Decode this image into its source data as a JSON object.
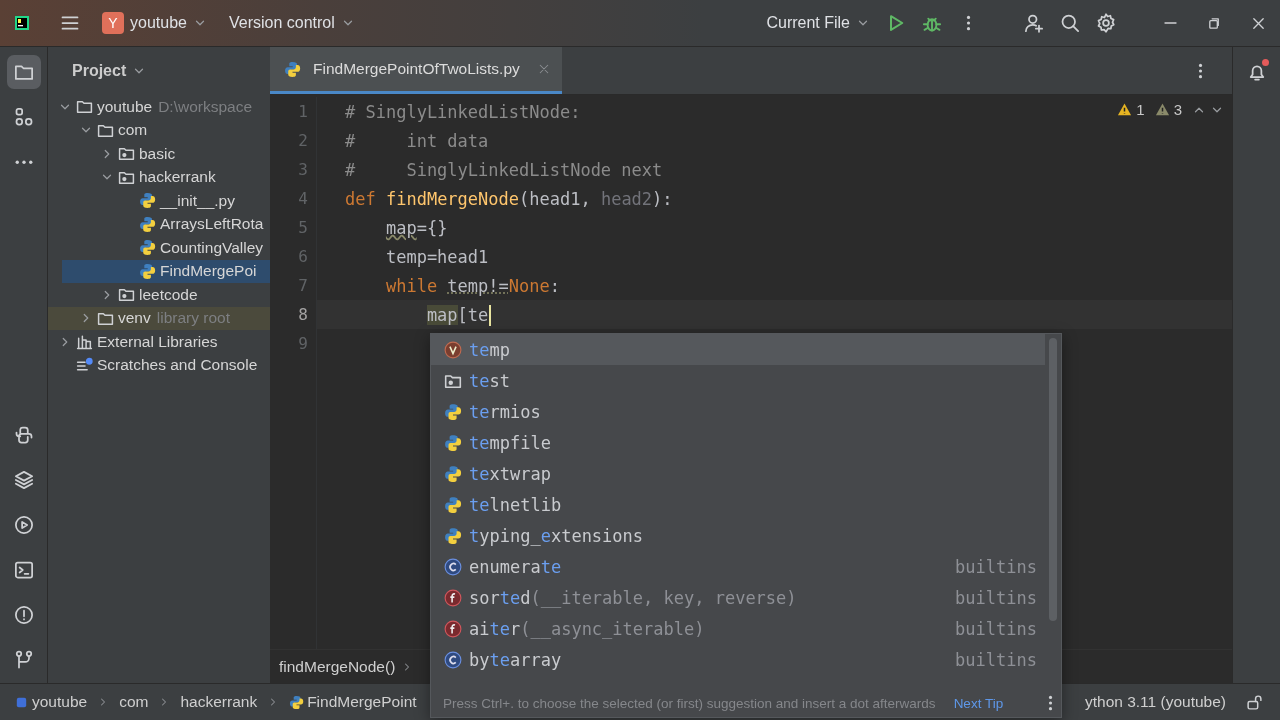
{
  "title_bar": {
    "project_badge": "Y",
    "project": "youtube",
    "vcs": "Version control",
    "run_config": "Current File"
  },
  "project_panel": {
    "title": "Project",
    "tree": [
      {
        "label": "youtube",
        "hint": "D:\\workspace",
        "kind": "folder",
        "expanded": true,
        "selected": false,
        "children": [
          {
            "label": "com",
            "kind": "folder",
            "expanded": true,
            "selected": false,
            "children": [
              {
                "label": "basic",
                "kind": "package",
                "expanded": false,
                "selected": false
              },
              {
                "label": "hackerrank",
                "kind": "package",
                "expanded": true,
                "selected": false,
                "children": [
                  {
                    "label": "__init__.py",
                    "kind": "python",
                    "selected": false
                  },
                  {
                    "label": "ArraysLeftRota",
                    "kind": "python",
                    "selected": false
                  },
                  {
                    "label": "CountingValley",
                    "kind": "python",
                    "selected": false
                  },
                  {
                    "label": "FindMergePoi",
                    "kind": "python",
                    "selected": true
                  }
                ]
              },
              {
                "label": "leetcode",
                "kind": "package",
                "expanded": false,
                "selected": false
              }
            ]
          },
          {
            "label": "venv",
            "hint": "library root",
            "kind": "library-root",
            "expanded": false,
            "selected": false
          }
        ]
      },
      {
        "label": "External Libraries",
        "kind": "libraries",
        "expanded": false,
        "selected": false
      },
      {
        "label": "Scratches and Console",
        "kind": "scratches",
        "selected": false
      }
    ]
  },
  "editor": {
    "tab": {
      "label": "FindMergePointOfTwoLists.py",
      "selected": true
    },
    "inspections": [
      {
        "kind": "warning",
        "count": "1"
      },
      {
        "kind": "weak-warning",
        "count": "3"
      }
    ],
    "lines": [
      {
        "number": "1",
        "current": false,
        "tokens": [
          {
            "kind": "comment",
            "text": "# SinglyLinkedListNode:"
          }
        ]
      },
      {
        "number": "2",
        "current": false,
        "tokens": [
          {
            "kind": "comment",
            "text": "#     int data"
          }
        ]
      },
      {
        "number": "3",
        "current": false,
        "tokens": [
          {
            "kind": "comment",
            "text": "#     SinglyLinkedListNode next"
          }
        ]
      },
      {
        "number": "4",
        "current": false,
        "tokens": [
          {
            "kind": "keyword",
            "text": "def "
          },
          {
            "kind": "function",
            "text": "findMergeNode"
          },
          {
            "kind": "plain",
            "text": "(head1, "
          },
          {
            "kind": "unused",
            "text": "head2"
          },
          {
            "kind": "plain",
            "text": "):"
          }
        ],
        "children": [
          {
            "number": "5",
            "current": false,
            "tokens": [
              {
                "kind": "warned",
                "text": "map"
              },
              {
                "kind": "plain",
                "text": "={}"
              }
            ]
          },
          {
            "number": "6",
            "current": false,
            "tokens": [
              {
                "kind": "plain",
                "text": "temp=head1"
              }
            ]
          },
          {
            "number": "7",
            "current": false,
            "tokens": [
              {
                "kind": "keyword",
                "text": "while "
              },
              {
                "kind": "dotted",
                "text": "temp!="
              },
              {
                "kind": "keyword",
                "text": "None"
              },
              {
                "kind": "plain",
                "text": ":"
              }
            ],
            "children": [
              {
                "number": "8",
                "current": true,
                "caret": true,
                "tokens": [
                  {
                    "kind": "highlight",
                    "text": "map"
                  },
                  {
                    "kind": "plain",
                    "text": "[te"
                  }
                ]
              }
            ]
          }
        ]
      },
      {
        "number": "9",
        "current": false
      }
    ],
    "breadcrumb": [
      "findMergeNode()"
    ]
  },
  "completion": {
    "items": [
      {
        "kind": "variable",
        "selected": true,
        "parts": [
          {
            "kind": "match",
            "text": "te"
          },
          {
            "kind": "text",
            "text": "mp"
          }
        ]
      },
      {
        "kind": "folder",
        "selected": false,
        "parts": [
          {
            "kind": "match",
            "text": "te"
          },
          {
            "kind": "text",
            "text": "st"
          }
        ]
      },
      {
        "kind": "python",
        "selected": false,
        "parts": [
          {
            "kind": "match",
            "text": "te"
          },
          {
            "kind": "text",
            "text": "rmios"
          }
        ]
      },
      {
        "kind": "python",
        "selected": false,
        "parts": [
          {
            "kind": "match",
            "text": "te"
          },
          {
            "kind": "text",
            "text": "mpfile"
          }
        ]
      },
      {
        "kind": "python",
        "selected": false,
        "parts": [
          {
            "kind": "match",
            "text": "te"
          },
          {
            "kind": "text",
            "text": "xtwrap"
          }
        ]
      },
      {
        "kind": "python",
        "selected": false,
        "parts": [
          {
            "kind": "match",
            "text": "te"
          },
          {
            "kind": "text",
            "text": "lnetlib"
          }
        ]
      },
      {
        "kind": "python",
        "selected": false,
        "parts": [
          {
            "kind": "match",
            "text": "t"
          },
          {
            "kind": "text",
            "text": "yping_"
          },
          {
            "kind": "match",
            "text": "e"
          },
          {
            "kind": "text",
            "text": "xtensions"
          }
        ]
      },
      {
        "kind": "class",
        "selected": false,
        "source": "builtins",
        "parts": [
          {
            "kind": "text",
            "text": "enumera"
          },
          {
            "kind": "match",
            "text": "te"
          }
        ]
      },
      {
        "kind": "function",
        "selected": false,
        "source": "builtins",
        "parts": [
          {
            "kind": "text",
            "text": "sor"
          },
          {
            "kind": "match",
            "text": "te"
          },
          {
            "kind": "text",
            "text": "d"
          },
          {
            "kind": "args",
            "text": "(__iterable, key, reverse)"
          }
        ]
      },
      {
        "kind": "function",
        "selected": false,
        "source": "builtins",
        "parts": [
          {
            "kind": "text",
            "text": "ai"
          },
          {
            "kind": "match",
            "text": "te"
          },
          {
            "kind": "text",
            "text": "r"
          },
          {
            "kind": "args",
            "text": "(__async_iterable)"
          }
        ]
      },
      {
        "kind": "class",
        "selected": false,
        "source": "builtins",
        "parts": [
          {
            "kind": "text",
            "text": "by"
          },
          {
            "kind": "match",
            "text": "te"
          },
          {
            "kind": "text",
            "text": "array"
          }
        ]
      }
    ],
    "hint": "Press Ctrl+. to choose the selected (or first) suggestion and insert a dot afterwards",
    "link": "Next Tip"
  },
  "status_bar": {
    "path": [
      {
        "kind": "module",
        "text": "youtube"
      },
      {
        "kind": "folder",
        "text": "com"
      },
      {
        "kind": "folder",
        "text": "hackerrank"
      },
      {
        "kind": "python",
        "text": "FindMergePoint"
      }
    ],
    "interpreter": "ython 3.11 (youtube)"
  },
  "notifications": {
    "unread": true
  }
}
